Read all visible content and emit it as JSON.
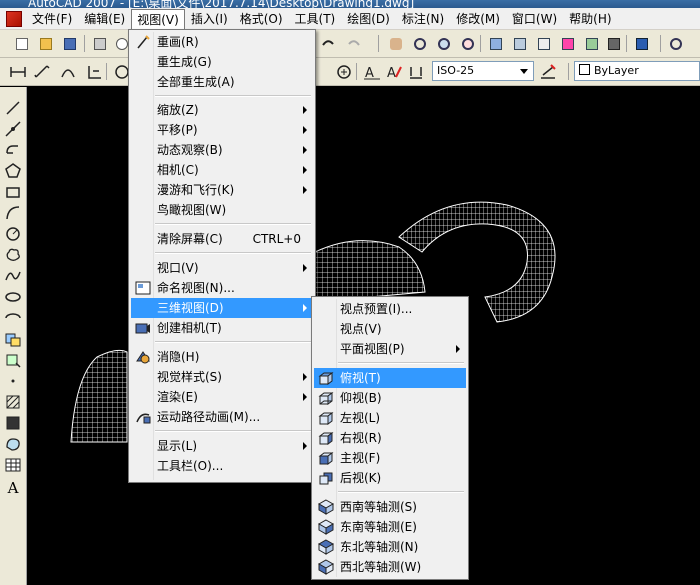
{
  "app": {
    "title_fragment": "AutoCAD 2007 - [E:\\桌面\\文件\\2017.7.14\\Desktop\\Drawing1.dwg]"
  },
  "menubar": {
    "items": [
      {
        "label": "文件(F)"
      },
      {
        "label": "编辑(E)"
      },
      {
        "label": "视图(V)"
      },
      {
        "label": "插入(I)"
      },
      {
        "label": "格式(O)"
      },
      {
        "label": "工具(T)"
      },
      {
        "label": "绘图(D)"
      },
      {
        "label": "标注(N)"
      },
      {
        "label": "修改(M)"
      },
      {
        "label": "窗口(W)"
      },
      {
        "label": "帮助(H)"
      }
    ]
  },
  "toolbar": {
    "dimstyle_value": "ISO-25",
    "layer_value": "ByLayer"
  },
  "view_menu": {
    "items": [
      {
        "label": "重画(R)"
      },
      {
        "label": "重生成(G)"
      },
      {
        "label": "全部重生成(A)"
      },
      {
        "label": "缩放(Z)"
      },
      {
        "label": "平移(P)"
      },
      {
        "label": "动态观察(B)"
      },
      {
        "label": "相机(C)"
      },
      {
        "label": "漫游和飞行(K)"
      },
      {
        "label": "鸟瞰视图(W)"
      },
      {
        "label": "清除屏幕(C)",
        "shortcut": "CTRL+0"
      },
      {
        "label": "视口(V)"
      },
      {
        "label": "命名视图(N)..."
      },
      {
        "label": "三维视图(D)"
      },
      {
        "label": "创建相机(T)"
      },
      {
        "label": "消隐(H)"
      },
      {
        "label": "视觉样式(S)"
      },
      {
        "label": "渲染(E)"
      },
      {
        "label": "运动路径动画(M)..."
      },
      {
        "label": "显示(L)"
      },
      {
        "label": "工具栏(O)..."
      }
    ]
  },
  "view3d_submenu": {
    "items": [
      {
        "label": "视点预置(I)..."
      },
      {
        "label": "视点(V)"
      },
      {
        "label": "平面视图(P)"
      },
      {
        "label": "俯视(T)"
      },
      {
        "label": "仰视(B)"
      },
      {
        "label": "左视(L)"
      },
      {
        "label": "右视(R)"
      },
      {
        "label": "主视(F)"
      },
      {
        "label": "后视(K)"
      },
      {
        "label": "西南等轴测(S)"
      },
      {
        "label": "东南等轴测(E)"
      },
      {
        "label": "东北等轴测(N)"
      },
      {
        "label": "西北等轴测(W)"
      }
    ]
  },
  "colors": {
    "highlight": "#3399ff",
    "annotation_arrow": "#e8252b",
    "canvas": "#000000"
  }
}
